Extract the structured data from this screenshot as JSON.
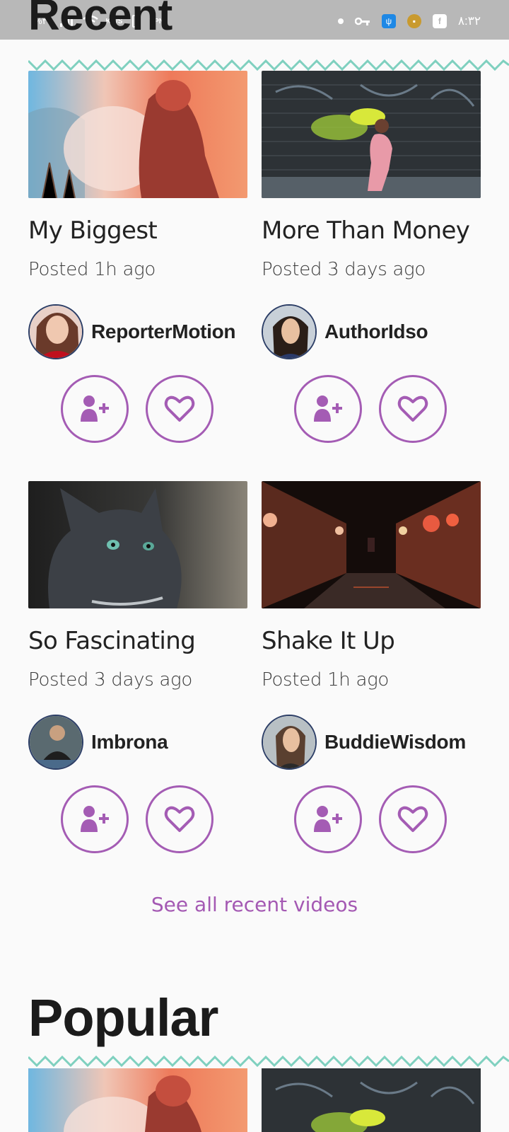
{
  "status_bar": {
    "left_text": "%٣٩",
    "speed_text": "KB/S",
    "vpn_text": "VPN",
    "time": "٨:٣٢"
  },
  "recent": {
    "heading": "Recent",
    "see_all": "See all recent videos",
    "cards": [
      {
        "title": "My Biggest",
        "posted": "Posted 1h ago",
        "author": "ReporterMotion"
      },
      {
        "title": "More Than Money",
        "posted": "Posted 3 days ago",
        "author": "AuthorIdso"
      },
      {
        "title": "So Fascinating",
        "posted": "Posted 3 days ago",
        "author": "Imbrona"
      },
      {
        "title": "Shake It Up",
        "posted": "Posted 1h ago",
        "author": "BuddieWisdom"
      }
    ]
  },
  "popular": {
    "heading": "Popular"
  },
  "colors": {
    "accent": "#a45cb4",
    "zigzag": "#7fd0bf",
    "status_bar": "#b8b8b8"
  },
  "icons": {
    "follow": "add-user-icon",
    "like": "heart-icon"
  }
}
